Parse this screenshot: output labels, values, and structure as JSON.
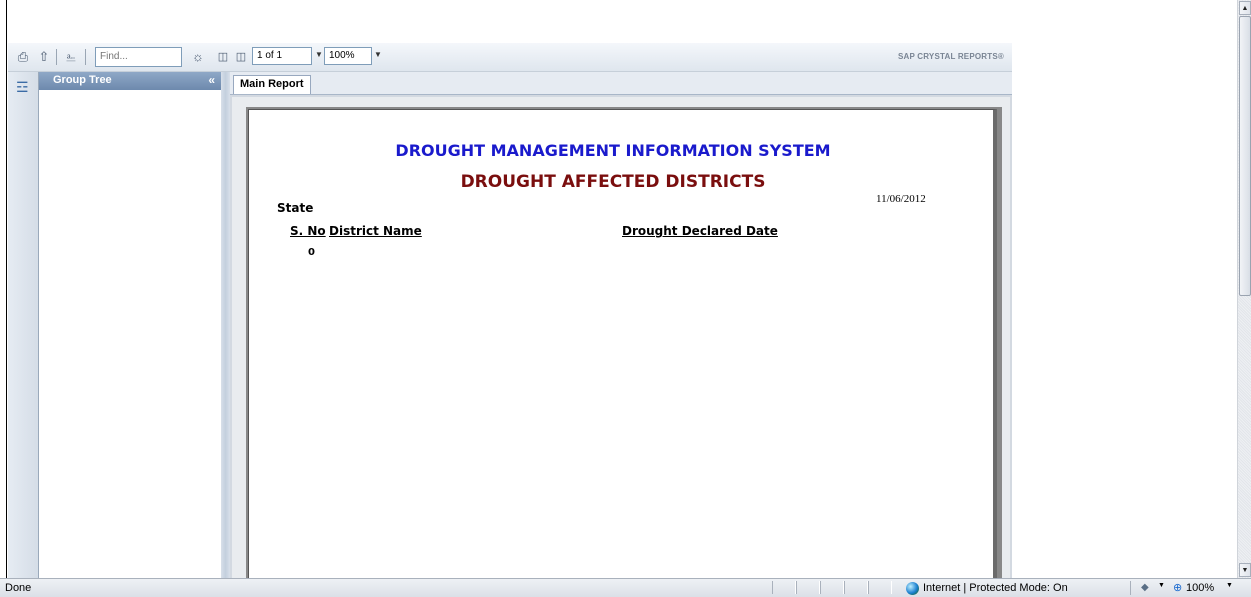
{
  "toolbar": {
    "find_placeholder": "Find...",
    "page_value": "1 of 1",
    "zoom_value": "100%",
    "brand": "SAP CRYSTAL REPORTS®"
  },
  "group_tree": {
    "title": "Group Tree",
    "collapse": "«"
  },
  "tabs": [
    {
      "label": "Main Report"
    }
  ],
  "report": {
    "title": "DROUGHT MANAGEMENT INFORMATION SYSTEM",
    "subtitle": "DROUGHT AFFECTED DISTRICTS",
    "date": "11/06/2012",
    "group_label": "State",
    "columns": [
      "S. No",
      "District Name",
      "Drought Declared Date"
    ],
    "rows": [
      {
        "sno": "0"
      }
    ],
    "colors": {
      "title": "#1a1acc",
      "subtitle": "#7a0e0e"
    }
  },
  "statusbar": {
    "status": "Done",
    "zone": "Internet | Protected Mode: On",
    "zoom": "100%"
  }
}
